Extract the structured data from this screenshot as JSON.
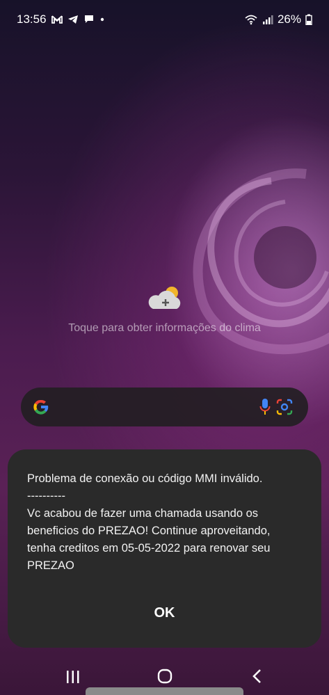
{
  "status_bar": {
    "time": "13:56",
    "battery": "26%",
    "notification_icons": [
      "gmail-icon",
      "telegram-icon",
      "messages-icon",
      "dot-icon"
    ]
  },
  "weather": {
    "label": "Toque para obter informações do clima"
  },
  "search": {
    "icons": [
      "google-logo-icon",
      "microphone-icon",
      "lens-camera-icon"
    ]
  },
  "dialog": {
    "line1": "Problema de conexão ou código MMI inválido.",
    "separator": "----------",
    "line2": "Vc acabou de fazer uma chamada usando os beneficios do PREZAO! Continue aproveitando, tenha creditos em 05-05-2022 para renovar seu PREZAO",
    "ok_label": "OK"
  },
  "colors": {
    "dialog_bg": "#2a2a2a",
    "search_bg": "#231e23"
  }
}
